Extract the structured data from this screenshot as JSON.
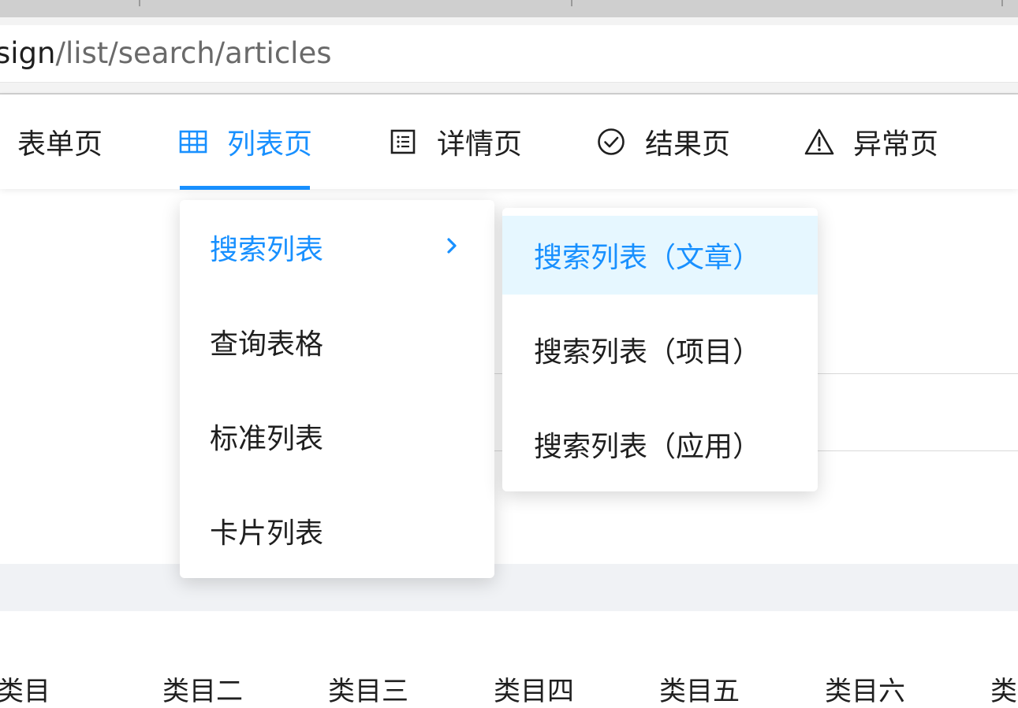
{
  "browser": {
    "url_host_fragment": "sign",
    "url_path": "/list/search/articles"
  },
  "nav": {
    "items": [
      {
        "label": "表单页",
        "icon": "none"
      },
      {
        "label": "列表页",
        "icon": "table-icon"
      },
      {
        "label": "详情页",
        "icon": "profile-icon"
      },
      {
        "label": "结果页",
        "icon": "check-circle-icon"
      },
      {
        "label": "异常页",
        "icon": "warning-icon"
      }
    ],
    "active_index": 1,
    "accent_color": "#1890ff"
  },
  "menu": {
    "items": [
      {
        "label": "搜索列表"
      },
      {
        "label": "查询表格"
      },
      {
        "label": "标准列表"
      },
      {
        "label": "卡片列表"
      }
    ],
    "active_index": 0
  },
  "submenu": {
    "items": [
      {
        "label": "搜索列表（文章）"
      },
      {
        "label": "搜索列表（项目）"
      },
      {
        "label": "搜索列表（应用）"
      }
    ],
    "active_index": 0,
    "active_bg": "#e6f7ff"
  },
  "categories": [
    "类目",
    "类目二",
    "类目三",
    "类目四",
    "类目五",
    "类目六",
    "类"
  ]
}
